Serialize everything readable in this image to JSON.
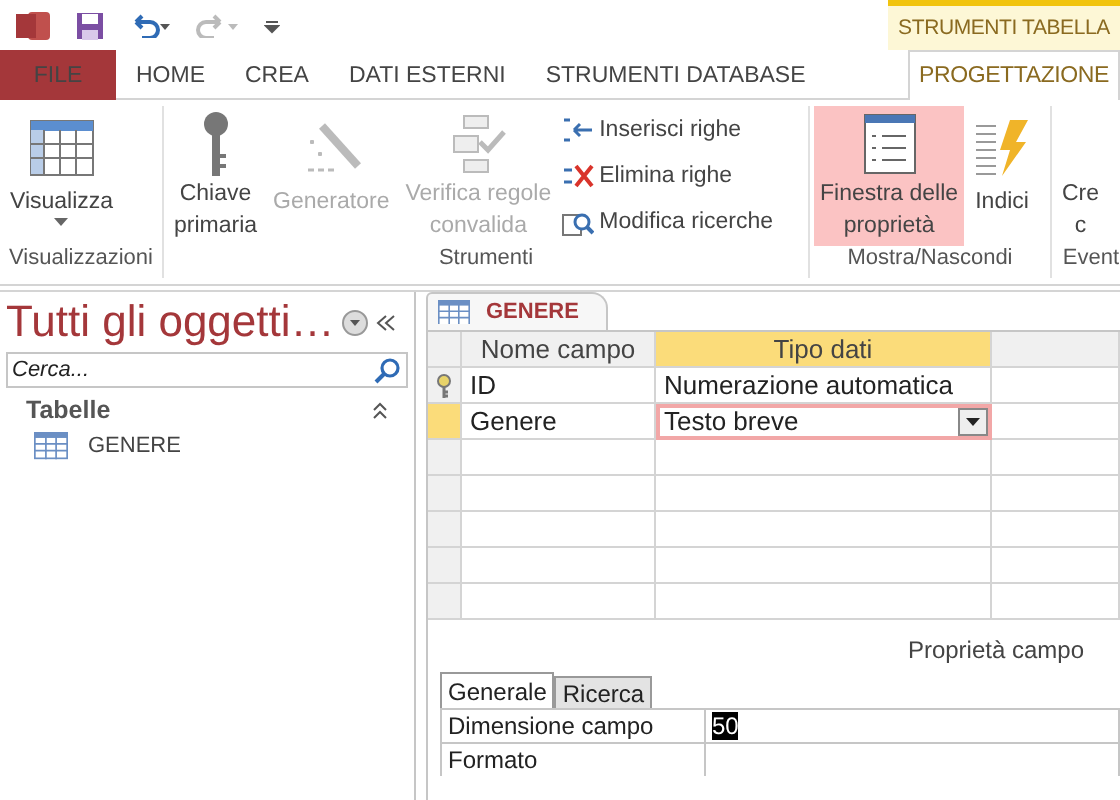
{
  "context_tab": "STRUMENTI TABELLA",
  "tabs": [
    {
      "label": "FILE",
      "kind": "file",
      "selected": false
    },
    {
      "label": "HOME",
      "kind": "normal",
      "selected": false
    },
    {
      "label": "CREA",
      "kind": "normal",
      "selected": false
    },
    {
      "label": "DATI ESTERNI",
      "kind": "normal",
      "selected": false
    },
    {
      "label": "STRUMENTI DATABASE",
      "kind": "normal",
      "selected": false
    },
    {
      "label": "PROGETTAZIONE",
      "kind": "context",
      "selected": true
    }
  ],
  "ribbon_groups": [
    {
      "label": "Visualizzazioni",
      "buttons": [
        {
          "label": "Visualizza",
          "kind": "large",
          "dropdown": true,
          "disabled": false,
          "selected": false
        }
      ]
    },
    {
      "label": "Strumenti",
      "buttons": [
        {
          "label": "Chiave\nprimaria",
          "kind": "large",
          "dropdown": false,
          "disabled": false,
          "selected": false
        },
        {
          "label": "Generatore",
          "kind": "large",
          "dropdown": false,
          "disabled": true,
          "selected": false
        },
        {
          "label": "Verifica regole\nconvalida",
          "kind": "large",
          "dropdown": false,
          "disabled": true,
          "selected": false
        },
        {
          "label": "Inserisci righe",
          "kind": "small",
          "disabled": false
        },
        {
          "label": "Elimina righe",
          "kind": "small",
          "disabled": false
        },
        {
          "label": "Modifica ricerche",
          "kind": "small",
          "disabled": false
        }
      ]
    },
    {
      "label": "Mostra/Nascondi",
      "buttons": [
        {
          "label": "Finestra delle\nproprietà",
          "kind": "large",
          "dropdown": false,
          "disabled": false,
          "selected": true
        },
        {
          "label": "Indici",
          "kind": "large",
          "dropdown": false,
          "disabled": false,
          "selected": false
        }
      ]
    },
    {
      "label": "Event",
      "buttons": [
        {
          "label": "Cre\nc",
          "kind": "large",
          "dropdown": false,
          "disabled": false,
          "selected": false
        }
      ]
    }
  ],
  "nav_pane": {
    "title": "Tutti gli oggetti…",
    "search": {
      "placeholder": "Cerca..."
    },
    "section": "Tabelle",
    "items": [
      "GENERE"
    ]
  },
  "document_tab": "GENERE",
  "design_grid": {
    "columns": [
      "Nome campo",
      "Tipo dati"
    ],
    "rows": [
      {
        "name": "ID",
        "type": "Numerazione automatica",
        "primary_key": true,
        "selected": false
      },
      {
        "name": "Genere",
        "type": "Testo breve",
        "primary_key": false,
        "selected": true
      }
    ]
  },
  "field_properties": {
    "title": "Proprietà campo",
    "tabs": [
      {
        "label": "Generale",
        "selected": true
      },
      {
        "label": "Ricerca",
        "selected": false
      }
    ],
    "rows": [
      {
        "label": "Dimensione campo",
        "value": "50",
        "value_selected": true
      },
      {
        "label": "Formato",
        "value": "",
        "value_selected": false
      }
    ]
  }
}
